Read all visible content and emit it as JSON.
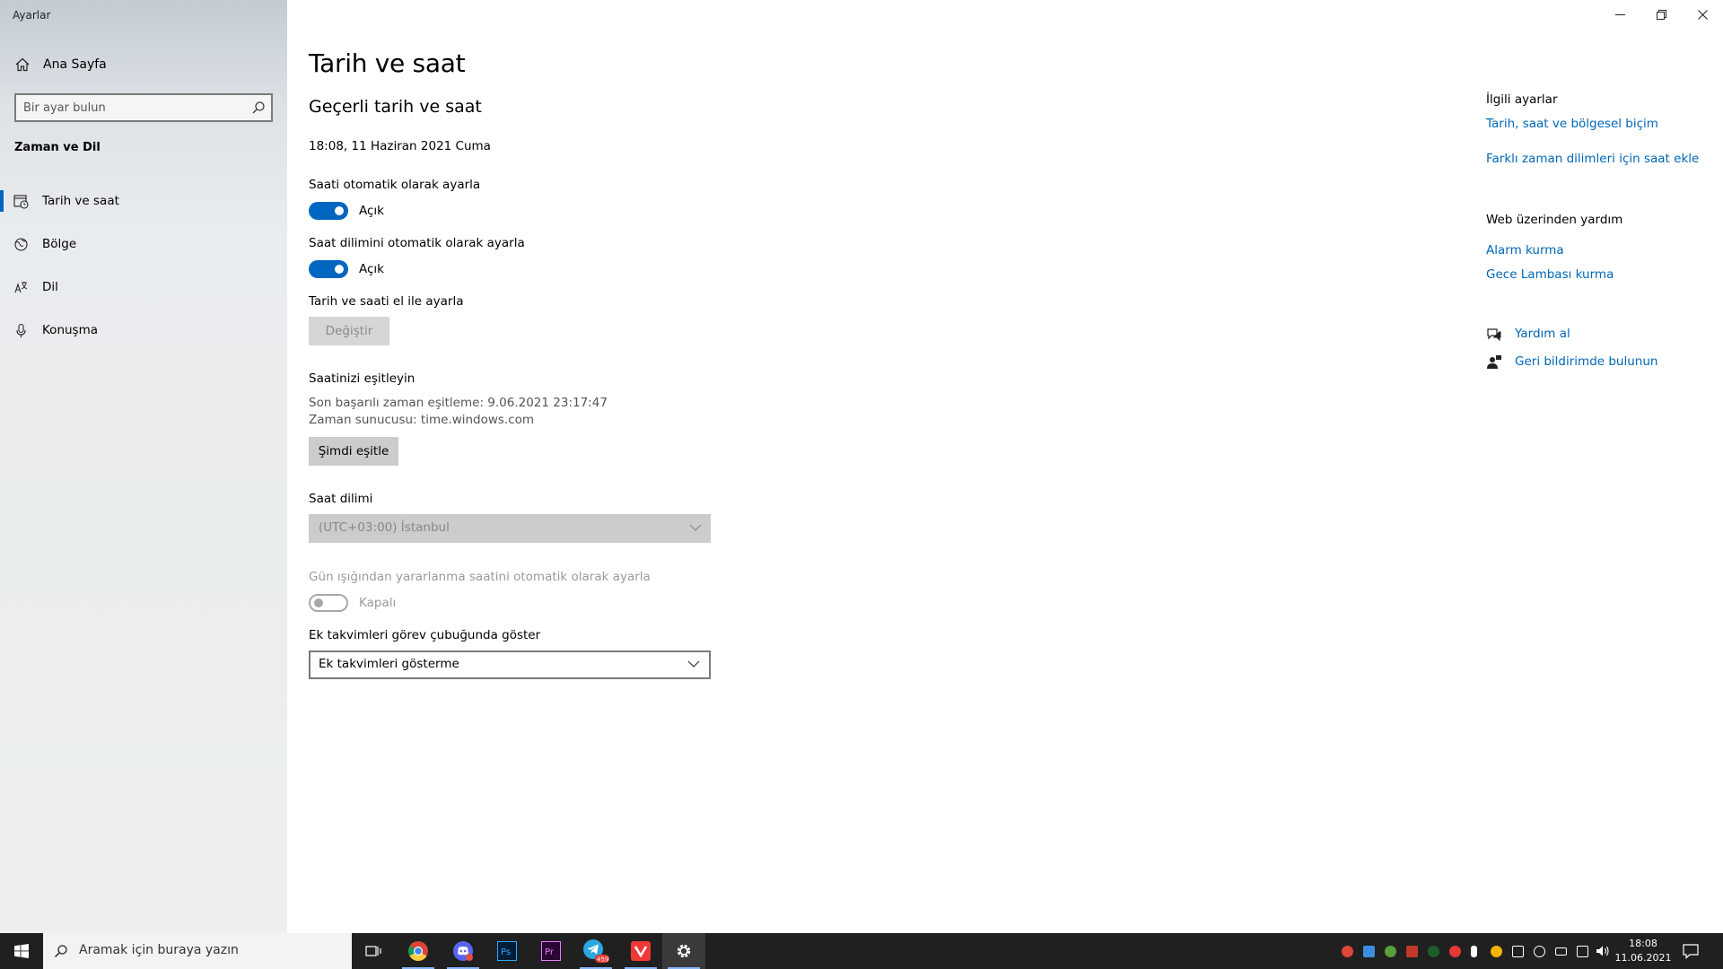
{
  "app": {
    "title": "Ayarlar"
  },
  "sidebar": {
    "home_label": "Ana Sayfa",
    "search_placeholder": "Bir ayar bulun",
    "section_title": "Zaman ve Dil",
    "items": [
      {
        "label": "Tarih ve saat",
        "icon": "date-time-icon",
        "active": true
      },
      {
        "label": "Bölge",
        "icon": "region-globe-icon",
        "active": false
      },
      {
        "label": "Dil",
        "icon": "language-icon",
        "active": false
      },
      {
        "label": "Konuşma",
        "icon": "microphone-icon",
        "active": false
      }
    ]
  },
  "main": {
    "page_title": "Tarih ve saat",
    "current_section_title": "Geçerli tarih ve saat",
    "current_datetime": "18:08, 11 Haziran 2021 Cuma",
    "auto_time": {
      "label": "Saati otomatik olarak ayarla",
      "state": "Açık",
      "on": true
    },
    "auto_timezone": {
      "label": "Saat dilimini otomatik olarak ayarla",
      "state": "Açık",
      "on": true
    },
    "manual": {
      "label": "Tarih ve saati el ile ayarla",
      "button": "Değiştir"
    },
    "sync": {
      "title": "Saatinizi eşitleyin",
      "last_sync": "Son başarılı zaman eşitleme:  9.06.2021 23:17:47",
      "server": "Zaman sunucusu:  time.windows.com",
      "button": "Şimdi eşitle"
    },
    "timezone": {
      "label": "Saat dilimi",
      "value": "(UTC+03:00) İstanbul"
    },
    "dst": {
      "label": "Gün ışığından yararlanma saatini otomatik olarak ayarla",
      "state": "Kapalı",
      "on": false
    },
    "extra_calendars": {
      "label": "Ek takvimleri görev çubuğunda göster",
      "value": "Ek takvimleri gösterme"
    }
  },
  "right_panel": {
    "related_title": "İlgili ayarlar",
    "related_links": [
      "Tarih, saat ve bölgesel biçim",
      "Farklı zaman dilimleri için saat ekle"
    ],
    "web_help_title": "Web üzerinden yardım",
    "web_help_links": [
      "Alarm kurma",
      "Gece Lambası kurma"
    ],
    "get_help": "Yardım al",
    "feedback": "Geri bildirimde bulunun"
  },
  "taskbar": {
    "search_placeholder": "Aramak için buraya yazın",
    "apps": [
      "task-view",
      "chrome",
      "discord",
      "photoshop",
      "premiere",
      "telegram",
      "vivaldi",
      "settings"
    ],
    "telegram_badge": "459",
    "time": "18:08",
    "date": "11.06.2021"
  },
  "colors": {
    "accent": "#0067c0",
    "link": "#0067b8",
    "taskbar": "#202020"
  }
}
